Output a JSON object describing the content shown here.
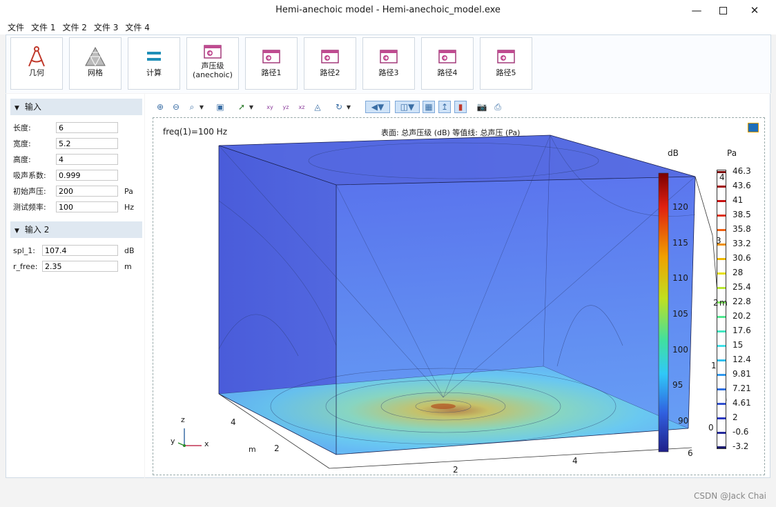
{
  "window": {
    "title": "Hemi-anechoic model - Hemi-anechoic_model.exe"
  },
  "menu": [
    "文件",
    "文件 1",
    "文件 2",
    "文件 3",
    "文件 4"
  ],
  "ribbon": [
    {
      "label": "几何",
      "icon": "geometry-icon"
    },
    {
      "label": "网格",
      "icon": "mesh-icon"
    },
    {
      "label": "计算",
      "icon": "compute-icon"
    },
    {
      "label": "声压级\n(anechoic)",
      "icon": "plot-icon"
    },
    {
      "label": "路径1",
      "icon": "plot-icon"
    },
    {
      "label": "路径2",
      "icon": "plot-icon"
    },
    {
      "label": "路径3",
      "icon": "plot-icon"
    },
    {
      "label": "路径4",
      "icon": "plot-icon"
    },
    {
      "label": "路径5",
      "icon": "plot-icon"
    }
  ],
  "input1": {
    "header": "输入",
    "fields": [
      {
        "label": "长度:",
        "value": "6",
        "unit": ""
      },
      {
        "label": "宽度:",
        "value": "5.2",
        "unit": ""
      },
      {
        "label": "高度:",
        "value": "4",
        "unit": ""
      },
      {
        "label": "吸声系数:",
        "value": "0.999",
        "unit": ""
      },
      {
        "label": "初始声压:",
        "value": "200",
        "unit": "Pa"
      },
      {
        "label": "测试频率:",
        "value": "100",
        "unit": "Hz"
      }
    ]
  },
  "input2": {
    "header": "输入 2",
    "fields": [
      {
        "label": "spl_1:",
        "value": "107.4",
        "unit": "dB"
      },
      {
        "label": "r_free:",
        "value": "2.35",
        "unit": "m"
      }
    ]
  },
  "plot": {
    "freq_label": "freq(1)=100 Hz",
    "title": "表面: 总声压级 (dB)  等值线: 总声压 (Pa)",
    "db_unit": "dB",
    "pa_unit": "Pa",
    "db_ticks": [
      "120",
      "115",
      "110",
      "105",
      "100",
      "95",
      "90"
    ],
    "pa_ticks": [
      "46.3",
      "43.6",
      "41",
      "38.5",
      "35.8",
      "33.2",
      "30.6",
      "28",
      "25.4",
      "22.8",
      "20.2",
      "17.6",
      "15",
      "12.4",
      "9.81",
      "7.21",
      "4.61",
      "2",
      "-0.6",
      "-3.2"
    ],
    "z_ticks": [
      "4",
      "3",
      "2",
      "1",
      "0"
    ],
    "z_unit": "m",
    "x_ticks": [
      "2",
      "4",
      "6"
    ],
    "y_ticks": [
      "4",
      "2"
    ],
    "y_unit": "m",
    "axis_labels": {
      "x": "x",
      "y": "y",
      "z": "z"
    }
  },
  "watermark": "CSDN @Jack Chai"
}
